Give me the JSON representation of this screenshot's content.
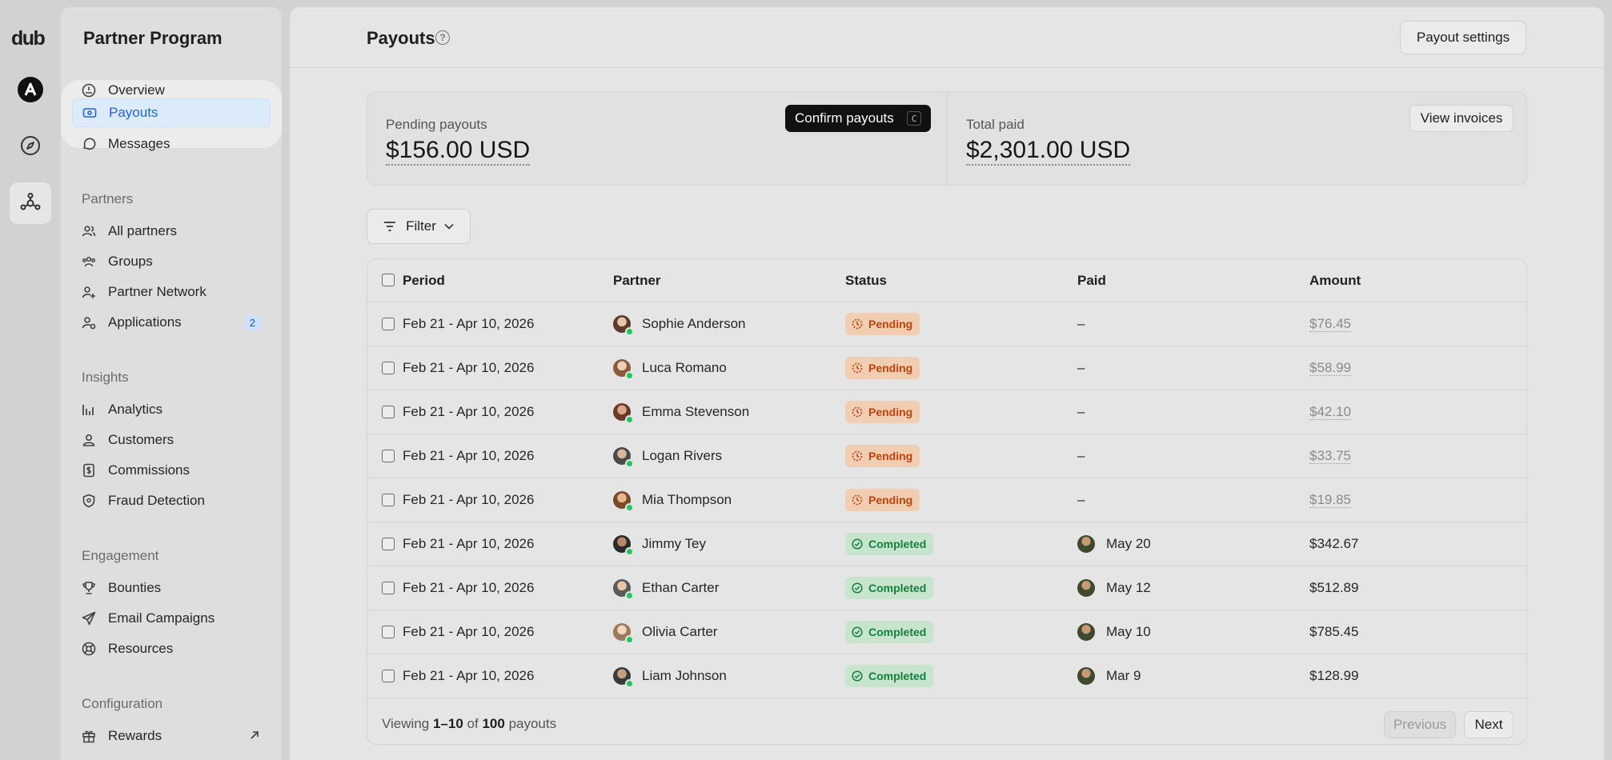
{
  "rail": {
    "logo": "dub"
  },
  "sidebar": {
    "title": "Partner Program",
    "top_items": [
      {
        "label": "Overview",
        "icon": "gauge-icon"
      },
      {
        "label": "Payouts",
        "icon": "money-icon",
        "active": true
      },
      {
        "label": "Messages",
        "icon": "message-icon"
      }
    ],
    "sections": [
      {
        "title": "Partners",
        "items": [
          {
            "label": "All partners",
            "icon": "users-icon"
          },
          {
            "label": "Groups",
            "icon": "users-group-icon"
          },
          {
            "label": "Partner Network",
            "icon": "user-plus-icon"
          },
          {
            "label": "Applications",
            "icon": "user-check-icon",
            "badge": "2"
          }
        ]
      },
      {
        "title": "Insights",
        "items": [
          {
            "label": "Analytics",
            "icon": "bar-chart-icon"
          },
          {
            "label": "Customers",
            "icon": "user-icon"
          },
          {
            "label": "Commissions",
            "icon": "invoice-dollar-icon"
          },
          {
            "label": "Fraud Detection",
            "icon": "shield-icon"
          }
        ]
      },
      {
        "title": "Engagement",
        "items": [
          {
            "label": "Bounties",
            "icon": "trophy-icon"
          },
          {
            "label": "Email Campaigns",
            "icon": "paper-plane-icon"
          },
          {
            "label": "Resources",
            "icon": "lifebuoy-icon"
          }
        ]
      },
      {
        "title": "Configuration",
        "items": [
          {
            "label": "Rewards",
            "icon": "gift-icon",
            "external": true
          }
        ]
      }
    ]
  },
  "header": {
    "title": "Payouts",
    "help_glyph": "?",
    "settings_label": "Payout settings"
  },
  "stats": {
    "pending": {
      "label": "Pending payouts",
      "value": "$156.00 USD",
      "button": "Confirm payouts",
      "shortcut": "C"
    },
    "total": {
      "label": "Total paid",
      "value": "$2,301.00 USD",
      "button": "View invoices"
    }
  },
  "filter": {
    "label": "Filter"
  },
  "table": {
    "columns": [
      "Period",
      "Partner",
      "Status",
      "Paid",
      "Amount"
    ],
    "rows": [
      {
        "period": "Feb 21 - Apr 10, 2026",
        "partner": "Sophie Anderson",
        "status": "Pending",
        "paid": "–",
        "amount": "$76.45"
      },
      {
        "period": "Feb 21 - Apr 10, 2026",
        "partner": "Luca Romano",
        "status": "Pending",
        "paid": "–",
        "amount": "$58.99"
      },
      {
        "period": "Feb 21 - Apr 10, 2026",
        "partner": "Emma Stevenson",
        "status": "Pending",
        "paid": "–",
        "amount": "$42.10"
      },
      {
        "period": "Feb 21 - Apr 10, 2026",
        "partner": "Logan Rivers",
        "status": "Pending",
        "paid": "–",
        "amount": "$33.75"
      },
      {
        "period": "Feb 21 - Apr 10, 2026",
        "partner": "Mia Thompson",
        "status": "Pending",
        "paid": "–",
        "amount": "$19.85"
      },
      {
        "period": "Feb 21 - Apr 10, 2026",
        "partner": "Jimmy Tey",
        "status": "Completed",
        "paid": "May 20",
        "amount": "$342.67"
      },
      {
        "period": "Feb 21 - Apr 10, 2026",
        "partner": "Ethan Carter",
        "status": "Completed",
        "paid": "May 12",
        "amount": "$512.89"
      },
      {
        "period": "Feb 21 - Apr 10, 2026",
        "partner": "Olivia Carter",
        "status": "Completed",
        "paid": "May 10",
        "amount": "$785.45"
      },
      {
        "period": "Feb 21 - Apr 10, 2026",
        "partner": "Liam Johnson",
        "status": "Completed",
        "paid": "Mar 9",
        "amount": "$128.99"
      }
    ]
  },
  "pagination": {
    "viewing_prefix": "Viewing",
    "range": "1–10",
    "of": "of",
    "total": "100",
    "noun": "payouts",
    "previous": "Previous",
    "next": "Next"
  },
  "colors": {
    "accent": "#2563eb",
    "pending": "#c2410c",
    "completed": "#15803d"
  }
}
